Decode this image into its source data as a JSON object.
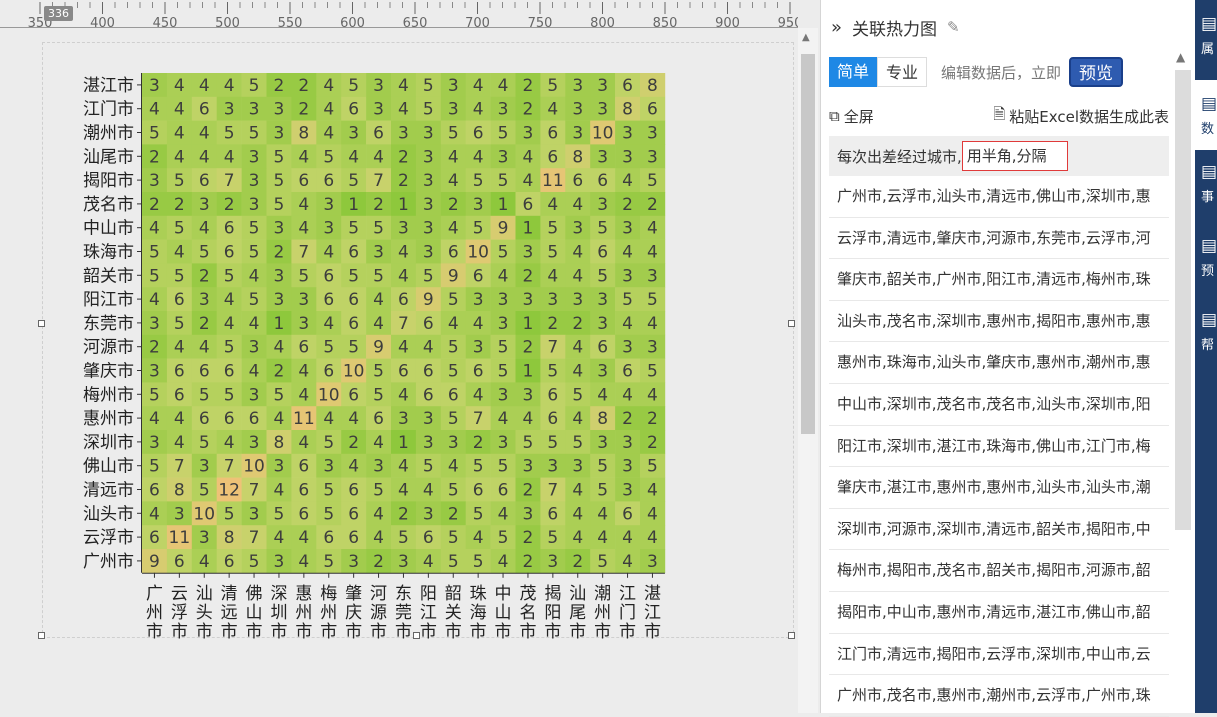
{
  "ruler": {
    "badge": "336",
    "ticks": [
      "350",
      "400",
      "450",
      "500",
      "550",
      "600",
      "650",
      "700",
      "750",
      "800",
      "850",
      "900",
      "950"
    ]
  },
  "panel": {
    "title": "关联热力图",
    "tabs": [
      {
        "label": "简单",
        "active": true
      },
      {
        "label": "专业",
        "active": false
      }
    ],
    "hint": "编辑数据后，立即",
    "preview_label": "预览",
    "fullscreen_label": "全屏",
    "paste_label": "粘贴Excel数据生成此表",
    "header_text": "每次出差经过城市,",
    "header_input": "用半角,分隔",
    "rows": [
      "广州市,云浮市,汕头市,清远市,佛山市,深圳市,惠",
      "云浮市,清远市,肇庆市,河源市,东莞市,云浮市,河",
      "肇庆市,韶关市,广州市,阳江市,清远市,梅州市,珠",
      "汕头市,茂名市,深圳市,惠州市,揭阳市,惠州市,惠",
      "惠州市,珠海市,汕头市,肇庆市,惠州市,潮州市,惠",
      "中山市,深圳市,茂名市,茂名市,汕头市,深圳市,阳",
      "阳江市,深圳市,湛江市,珠海市,佛山市,江门市,梅",
      "肇庆市,湛江市,惠州市,惠州市,汕头市,汕头市,潮",
      "深圳市,河源市,深圳市,清远市,韶关市,揭阳市,中",
      "梅州市,揭阳市,茂名市,韶关市,揭阳市,河源市,韶",
      "揭阳市,中山市,惠州市,清远市,湛江市,佛山市,韶",
      "江门市,清远市,揭阳市,云浮市,深圳市,中山市,云",
      "广州市,茂名市,惠州市,潮州市,云浮市,广州市,珠"
    ]
  },
  "rail": [
    {
      "icon": "属性",
      "label": "属",
      "active": false
    },
    {
      "icon": "数据",
      "label": "数",
      "active": true
    },
    {
      "icon": "事件",
      "label": "事",
      "active": false
    },
    {
      "icon": "预警",
      "label": "预",
      "active": false
    },
    {
      "icon": "帮助",
      "label": "帮",
      "active": false
    }
  ],
  "colors": {
    "low": "#8ec83c",
    "mid": "#c4d46a",
    "high": "#eec277",
    "accent": "#1e88e5",
    "rail": "#1f3e6b"
  },
  "chart_data": {
    "type": "heatmap",
    "title": "",
    "x_categories": [
      "广州市",
      "云浮市",
      "汕头市",
      "清远市",
      "佛山市",
      "深圳市",
      "惠州市",
      "梅州市",
      "肇庆市",
      "河源市",
      "东莞市",
      "阳江市",
      "韶关市",
      "珠海市",
      "中山市",
      "茂名市",
      "揭阳市",
      "汕尾市",
      "潮州市",
      "江门市",
      "湛江市"
    ],
    "y_categories": [
      "湛江市",
      "江门市",
      "潮州市",
      "汕尾市",
      "揭阳市",
      "茂名市",
      "中山市",
      "珠海市",
      "韶关市",
      "阳江市",
      "东莞市",
      "河源市",
      "肇庆市",
      "梅州市",
      "惠州市",
      "深圳市",
      "佛山市",
      "清远市",
      "汕头市",
      "云浮市",
      "广州市"
    ],
    "values": [
      [
        3,
        4,
        4,
        4,
        5,
        2,
        2,
        4,
        5,
        3,
        4,
        5,
        3,
        4,
        4,
        2,
        5,
        3,
        3,
        6,
        8
      ],
      [
        4,
        4,
        6,
        3,
        3,
        3,
        2,
        4,
        6,
        3,
        4,
        5,
        3,
        4,
        3,
        2,
        4,
        3,
        3,
        8,
        6
      ],
      [
        5,
        4,
        4,
        5,
        5,
        3,
        8,
        4,
        3,
        6,
        3,
        3,
        5,
        6,
        5,
        3,
        6,
        3,
        10,
        3,
        3
      ],
      [
        2,
        4,
        4,
        4,
        3,
        5,
        4,
        5,
        4,
        4,
        2,
        3,
        4,
        4,
        3,
        4,
        6,
        8,
        3,
        3,
        3
      ],
      [
        3,
        5,
        6,
        7,
        3,
        5,
        6,
        6,
        5,
        7,
        2,
        3,
        4,
        5,
        5,
        4,
        11,
        6,
        6,
        4,
        5
      ],
      [
        2,
        2,
        3,
        2,
        3,
        5,
        4,
        3,
        1,
        2,
        1,
        3,
        2,
        3,
        1,
        6,
        4,
        4,
        3,
        2,
        2
      ],
      [
        4,
        5,
        4,
        6,
        5,
        3,
        4,
        3,
        5,
        5,
        3,
        3,
        4,
        5,
        9,
        1,
        5,
        3,
        5,
        3,
        4
      ],
      [
        5,
        4,
        5,
        6,
        5,
        2,
        7,
        4,
        6,
        3,
        4,
        3,
        6,
        10,
        5,
        3,
        5,
        4,
        6,
        4,
        4
      ],
      [
        5,
        5,
        2,
        5,
        4,
        3,
        5,
        6,
        5,
        5,
        4,
        5,
        9,
        6,
        4,
        2,
        4,
        4,
        5,
        3,
        3
      ],
      [
        4,
        6,
        3,
        4,
        5,
        3,
        3,
        6,
        6,
        4,
        6,
        9,
        5,
        3,
        3,
        3,
        3,
        3,
        3,
        5,
        5
      ],
      [
        3,
        5,
        2,
        4,
        4,
        1,
        3,
        4,
        6,
        4,
        7,
        6,
        4,
        4,
        3,
        1,
        2,
        2,
        3,
        4,
        4
      ],
      [
        2,
        4,
        4,
        5,
        3,
        4,
        6,
        5,
        5,
        9,
        4,
        4,
        5,
        3,
        5,
        2,
        7,
        4,
        6,
        3,
        3
      ],
      [
        3,
        6,
        6,
        6,
        4,
        2,
        4,
        6,
        10,
        5,
        6,
        6,
        5,
        6,
        5,
        1,
        5,
        4,
        3,
        6,
        5
      ],
      [
        5,
        6,
        5,
        5,
        3,
        5,
        4,
        10,
        6,
        5,
        4,
        6,
        6,
        4,
        3,
        3,
        6,
        5,
        4,
        4,
        4
      ],
      [
        4,
        4,
        6,
        6,
        6,
        4,
        11,
        4,
        4,
        6,
        3,
        3,
        5,
        7,
        4,
        4,
        6,
        4,
        8,
        2,
        2
      ],
      [
        3,
        4,
        5,
        4,
        3,
        8,
        4,
        5,
        2,
        4,
        1,
        3,
        3,
        2,
        3,
        5,
        5,
        5,
        3,
        3,
        2
      ],
      [
        5,
        7,
        3,
        7,
        10,
        3,
        6,
        3,
        4,
        3,
        4,
        5,
        4,
        5,
        5,
        3,
        3,
        3,
        5,
        3,
        5
      ],
      [
        6,
        8,
        5,
        12,
        7,
        4,
        6,
        5,
        6,
        5,
        4,
        4,
        5,
        6,
        6,
        2,
        7,
        4,
        5,
        3,
        4
      ],
      [
        4,
        3,
        10,
        5,
        3,
        5,
        6,
        5,
        6,
        4,
        2,
        3,
        2,
        5,
        4,
        3,
        6,
        4,
        4,
        6,
        4
      ],
      [
        6,
        11,
        3,
        8,
        7,
        4,
        4,
        6,
        6,
        4,
        5,
        6,
        5,
        4,
        5,
        2,
        5,
        4,
        4,
        4,
        4
      ],
      [
        9,
        6,
        4,
        6,
        5,
        3,
        4,
        5,
        3,
        2,
        3,
        4,
        5,
        5,
        4,
        2,
        3,
        2,
        5,
        4,
        3
      ]
    ]
  }
}
